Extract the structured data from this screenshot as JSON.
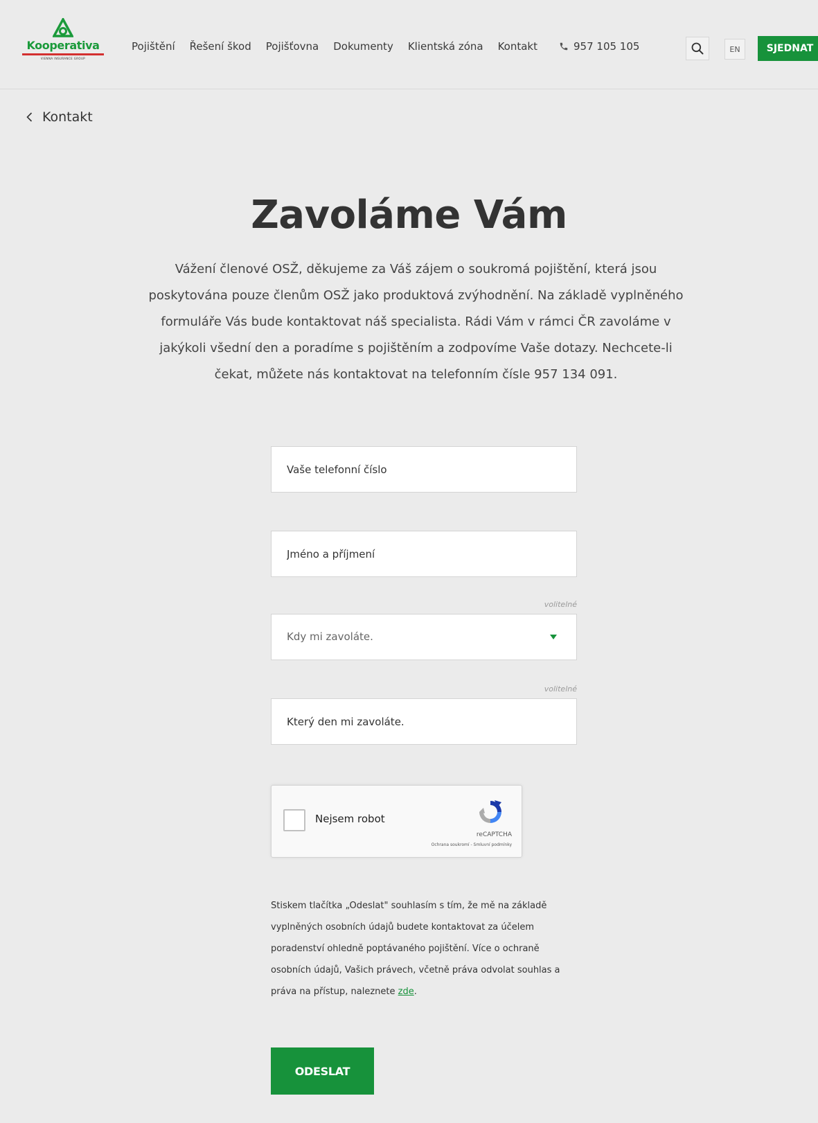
{
  "brand": {
    "name": "Kooperativa",
    "tagline": "VIENNA INSURANCE GROUP",
    "colors": {
      "primary_green": "#17923b",
      "accent_red": "#d32f2f",
      "background": "#ebebeb"
    }
  },
  "nav": {
    "items": [
      {
        "label": "Pojištění"
      },
      {
        "label": "Řešení škod"
      },
      {
        "label": "Pojišťovna"
      },
      {
        "label": "Dokumenty"
      },
      {
        "label": "Klientská zóna"
      },
      {
        "label": "Kontakt"
      }
    ],
    "phone": "957 105 105",
    "phone_icon": "phone-icon",
    "search_icon": "search-icon",
    "language": "EN",
    "cta_label": "SJEDNAT"
  },
  "breadcrumb": {
    "back_label": "Kontakt",
    "icon": "chevron-left-icon"
  },
  "page": {
    "title": "Zavoláme Vám",
    "intro": "Vážení členové OSŽ, děkujeme za Váš zájem o soukromá pojištění, která jsou poskytována pouze členům OSŽ jako produktová zvýhodnění. Na základě vyplněného formuláře Vás bude kontaktovat náš specialista. Rádi Vám v rámci ČR zavoláme v jakýkoli všední den a poradíme s pojištěním a zodpovíme Vaše dotazy. Nechcete-li čekat, můžete nás kontaktovat na telefonním čísle 957 134 091."
  },
  "form": {
    "phone": {
      "value": "",
      "placeholder": "Vaše telefonní číslo"
    },
    "name": {
      "value": "",
      "placeholder": "Jméno a příjmení"
    },
    "time": {
      "optional_label": "volitelné",
      "selected": "Kdy mi zavoláte.",
      "icon": "caret-down-icon"
    },
    "day": {
      "optional_label": "volitelné",
      "value": "",
      "placeholder": "Který den mi zavoláte."
    },
    "captcha": {
      "label": "Nejsem robot",
      "brand": "reCAPTCHA",
      "links": "Ochrana soukromí - Smluvní podmínky",
      "checked": false
    },
    "consent": {
      "text": "Stiskem tlačítka „Odeslat\" souhlasím s tím, že mě na základě vyplněných osobních údajů budete kontaktovat za účelem poradenství ohledně poptávaného pojištění. Více o ochraně osobních údajů, Vašich právech, včetně práva odvolat souhlas a práva na přístup, naleznete ",
      "link_label": "zde",
      "suffix": "."
    },
    "submit_label": "ODESLAT"
  }
}
